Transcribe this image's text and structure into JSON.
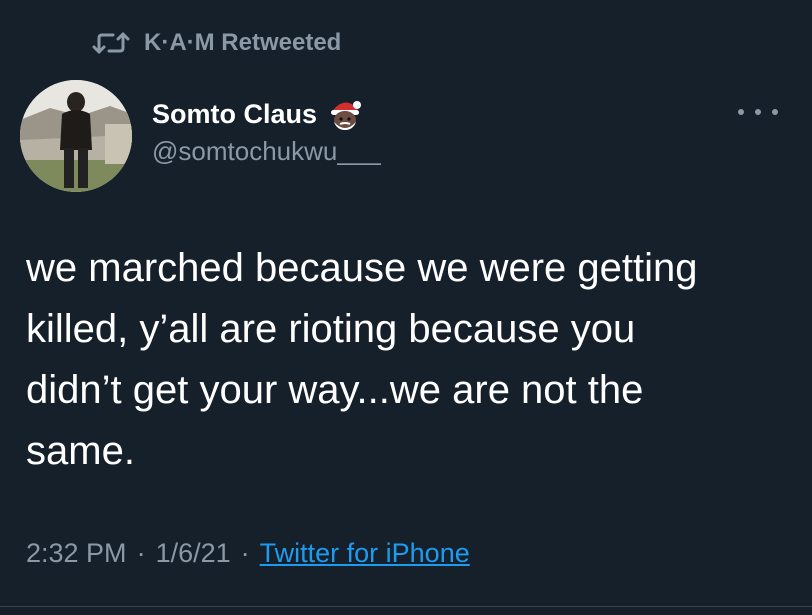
{
  "retweet": {
    "icon": "retweet-icon",
    "text": "K·A·M Retweeted"
  },
  "author": {
    "display_name": "Somto Claus",
    "name_emoji": "santa-emoji",
    "handle": "@somtochukwu___",
    "avatar": "avatar-photo"
  },
  "menu": {
    "icon": "more-options-icon"
  },
  "tweet": {
    "lines": [
      "we marched because we were getting",
      "killed, y’all are rioting because you",
      "didn’t get your way...we are not the",
      "same."
    ]
  },
  "meta": {
    "time": "2:32 PM",
    "separator": "·",
    "date": "1/6/21",
    "source": "Twitter for iPhone"
  },
  "colors": {
    "background": "#15202b",
    "secondary_text": "#8b98a5",
    "link": "#1d9bf0",
    "primary_text": "#ffffff"
  }
}
